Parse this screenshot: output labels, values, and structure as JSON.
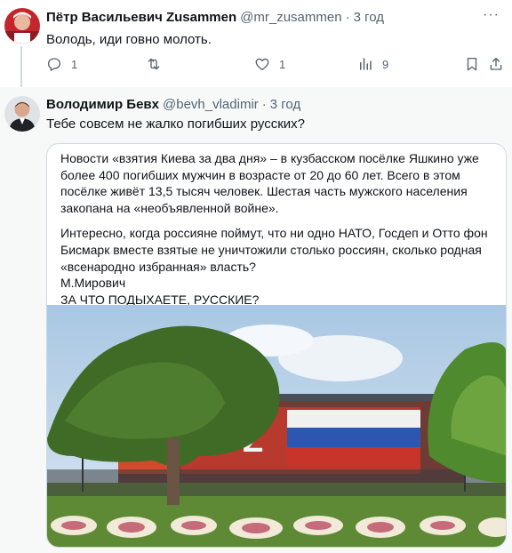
{
  "tweets": [
    {
      "author_name": "Пётр Васильевич Zusammen",
      "handle": "@mr_zusammen",
      "separator": "·",
      "time": "3 год",
      "text": "Володь, иди говно молоть.",
      "more": "···",
      "actions": {
        "reply_count": "1",
        "retweet_count": "",
        "like_count": "1",
        "views_count": "9"
      },
      "icons": [
        "reply-icon",
        "retweet-icon",
        "like-icon",
        "views-icon",
        "bookmark-icon",
        "share-icon"
      ]
    },
    {
      "author_name": "Володимир Бевх",
      "handle": "@bevh_vladimir",
      "separator": "·",
      "time": "3 год",
      "text": "Тебе совсем не жалко погибших русских?",
      "card": {
        "paragraph1": "Новости «взятия Киева за два дня» – в кузбасском посёлке Яшкино уже более 400 погибших мужчин в возрасте от 20 до 60 лет. Всего в этом посёлке живёт 13,5 тысяч человек. Шестая часть мужского населения закопана на «необъявленной войне».",
        "paragraph2": "Интересно, когда россияне поймут, что ни одно НАТО, Госдеп и Отто фон Бисмарк вместе взятые не уничтожили столько россиян, сколько родная «всенародно избранная» власть?",
        "author": "М.Мирович",
        "closing": "ЗА ЧТО ПОДЫХАЕТЕ, РУССКИЕ?"
      }
    }
  ],
  "colors": {
    "text": "#0f1419",
    "secondary": "#536471",
    "border": "#cfd9de",
    "reply_background": "#f7f9f9"
  }
}
